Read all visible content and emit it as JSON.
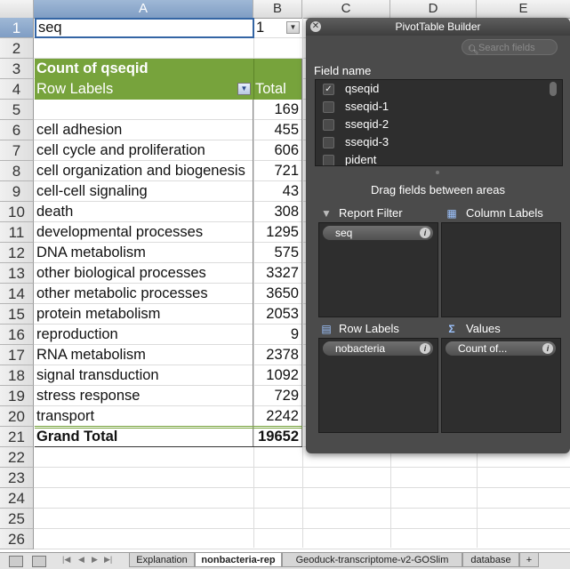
{
  "columns": [
    "A",
    "B",
    "C",
    "D",
    "E"
  ],
  "rows": [
    "1",
    "2",
    "3",
    "4",
    "5",
    "6",
    "7",
    "8",
    "9",
    "10",
    "11",
    "12",
    "13",
    "14",
    "15",
    "16",
    "17",
    "18",
    "19",
    "20",
    "21",
    "22",
    "23",
    "24",
    "25",
    "26"
  ],
  "sheet": {
    "filter_label": "seq",
    "filter_value": "1",
    "count_header": "Count of qseqid",
    "row_labels_header": "Row Labels",
    "total_header": "Total",
    "data": [
      {
        "label": "",
        "value": "169"
      },
      {
        "label": "cell adhesion",
        "value": "455"
      },
      {
        "label": "cell cycle and proliferation",
        "value": "606"
      },
      {
        "label": "cell organization and biogenesis",
        "value": "721"
      },
      {
        "label": "cell-cell signaling",
        "value": "43"
      },
      {
        "label": "death",
        "value": "308"
      },
      {
        "label": "developmental processes",
        "value": "1295"
      },
      {
        "label": "DNA metabolism",
        "value": "575"
      },
      {
        "label": "other biological processes",
        "value": "3327"
      },
      {
        "label": "other metabolic processes",
        "value": "3650"
      },
      {
        "label": "protein metabolism",
        "value": "2053"
      },
      {
        "label": "reproduction",
        "value": "9"
      },
      {
        "label": "RNA metabolism",
        "value": "2378"
      },
      {
        "label": "signal transduction",
        "value": "1092"
      },
      {
        "label": "stress response",
        "value": "729"
      },
      {
        "label": "transport",
        "value": "2242"
      }
    ],
    "grand_total_label": "Grand Total",
    "grand_total_value": "19652"
  },
  "pivot": {
    "title": "PivotTable Builder",
    "search_placeholder": "Search fields",
    "field_name_label": "Field name",
    "fields": [
      {
        "label": "qseqid",
        "checked": true
      },
      {
        "label": "sseqid-1",
        "checked": false
      },
      {
        "label": "sseqid-2",
        "checked": false
      },
      {
        "label": "sseqid-3",
        "checked": false
      },
      {
        "label": "pident",
        "checked": false
      }
    ],
    "drag_hint": "Drag fields between areas",
    "report_filter_label": "Report Filter",
    "column_labels_label": "Column Labels",
    "row_labels_label": "Row Labels",
    "values_label": "Values",
    "report_filter_item": "seq",
    "row_labels_item": "nobacteria",
    "values_item": "Count of...",
    "info_glyph": "i"
  },
  "tabs": [
    "Explanation",
    "nonbacteria-rep",
    "Geoduck-transcriptome-v2-GOSlim",
    "database",
    "+"
  ],
  "icons": {
    "close": "close-icon",
    "search": "search-icon",
    "filter": "filter-icon",
    "dropdown": "dropdown-arrow-icon",
    "values": "sigma-icon"
  },
  "colors": {
    "header_green": "#77a33c",
    "panel_bg": "#4b4b4b"
  }
}
